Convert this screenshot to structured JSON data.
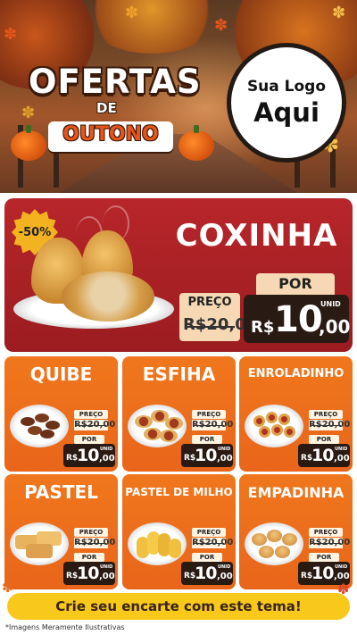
{
  "hero": {
    "title_main": "OFERTAS",
    "title_de": "DE",
    "title_season": "OUTONO",
    "logo_line1": "Sua Logo",
    "logo_line2": "Aqui"
  },
  "featured": {
    "discount_badge": "-50%",
    "name": "COXINHA",
    "old_price_label": "PREÇO",
    "old_price": "R$20,00",
    "old_price_number": "20,00",
    "old_price_prefix": "R$",
    "new_price_label": "POR",
    "currency": "R$",
    "new_price_int": "10",
    "new_price_cents": ",00",
    "unit": "UNID"
  },
  "products": [
    {
      "name": "QUIBE",
      "old_label": "PREÇO",
      "old_price": "R$20,00",
      "new_label": "POR",
      "currency": "R$",
      "price_int": "10",
      "price_cents": ",00",
      "unit": "UNID"
    },
    {
      "name": "ESFIHA",
      "old_label": "PREÇO",
      "old_price": "R$20,00",
      "new_label": "POR",
      "currency": "R$",
      "price_int": "10",
      "price_cents": ",00",
      "unit": "UNID"
    },
    {
      "name": "ENROLADINHO",
      "old_label": "PREÇO",
      "old_price": "R$20,00",
      "new_label": "POR",
      "currency": "R$",
      "price_int": "10",
      "price_cents": ",00",
      "unit": "UNID"
    },
    {
      "name": "PASTEL",
      "old_label": "PREÇO",
      "old_price": "R$20,00",
      "new_label": "POR",
      "currency": "R$",
      "price_int": "10",
      "price_cents": ",00",
      "unit": "UNID"
    },
    {
      "name": "PASTEL DE MILHO",
      "old_label": "PREÇO",
      "old_price": "R$20,00",
      "new_label": "POR",
      "currency": "R$",
      "price_int": "10",
      "price_cents": ",00",
      "unit": "UNID"
    },
    {
      "name": "EMPADINHA",
      "old_label": "PREÇO",
      "old_price": "R$20,00",
      "new_label": "POR",
      "currency": "R$",
      "price_int": "10",
      "price_cents": ",00",
      "unit": "UNID"
    }
  ],
  "footer": {
    "cta": "Crie seu encarte com este tema!",
    "disclaimer": "*Imagens Meramente Ilustrativas"
  },
  "colors": {
    "feature_red": "#b8262a",
    "card_orange": "#f0771d",
    "price_dark": "#2a1a14",
    "cta_yellow": "#f8c91b",
    "badge_yellow": "#f3b321"
  }
}
